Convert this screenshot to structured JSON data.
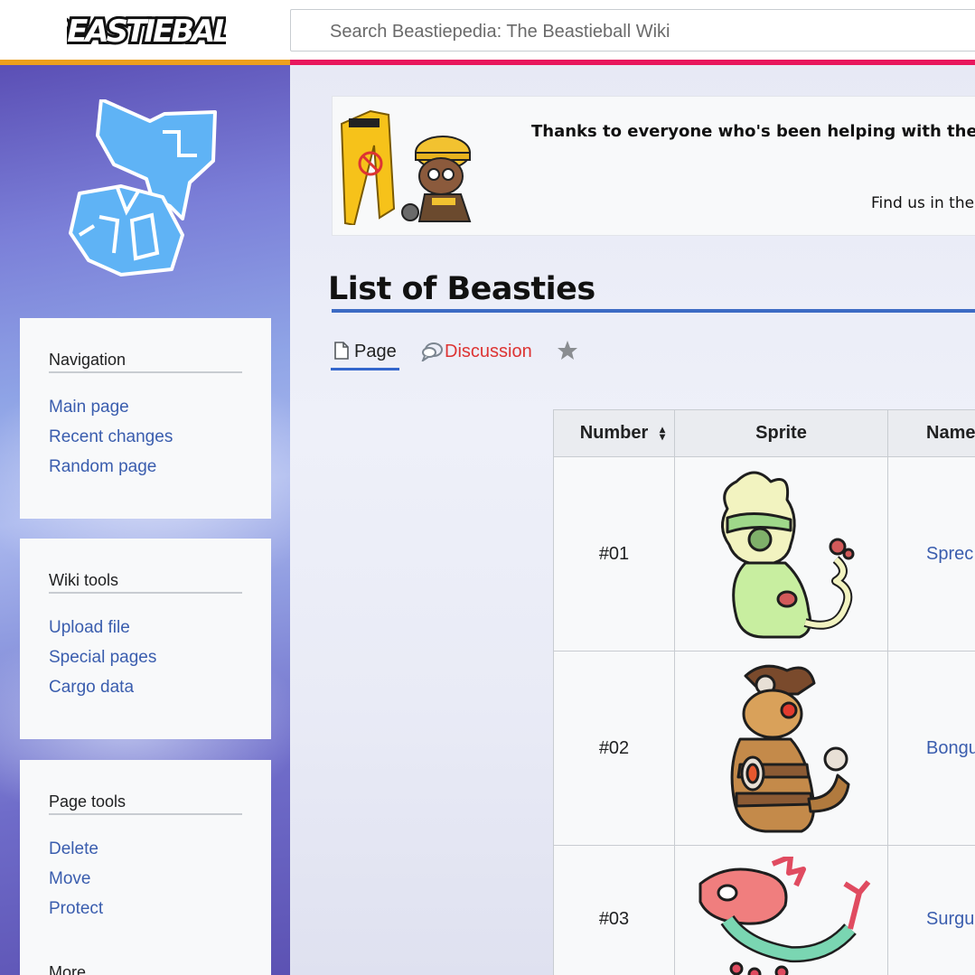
{
  "header": {
    "logo_text": "BEASTIEBALL",
    "search_placeholder": "Search Beastiepedia: The Beastieball Wiki"
  },
  "colors": {
    "accent_orange": "#ec9f1d",
    "accent_pink": "#e8175d",
    "link": "#3a5dae",
    "redlink": "#d33",
    "title_rule": "#3d6bc4"
  },
  "sidebar": {
    "emblem": "site-emblem-logo",
    "portlets": [
      {
        "title": "Navigation",
        "links": [
          "Main page",
          "Recent changes",
          "Random page"
        ]
      },
      {
        "title": "Wiki tools",
        "links": [
          "Upload file",
          "Special pages",
          "Cargo data"
        ]
      },
      {
        "title": "Page tools",
        "links": [
          "Delete",
          "Move",
          "Protect"
        ],
        "more": "More"
      }
    ]
  },
  "banner": {
    "thanks": "Thanks to everyone who's been helping with the site",
    "find": "Find us in the",
    "art": "caution-wet-floor-sign-and-construction-worker"
  },
  "page": {
    "title": "List of Beasties",
    "tabs": {
      "page": "Page",
      "discussion": "Discussion"
    },
    "icons": {
      "page": "page-icon",
      "discussion": "discussion-icon",
      "watch": "star-icon"
    }
  },
  "table": {
    "headers": {
      "number": "Number",
      "sprite": "Sprite",
      "name": "Name"
    },
    "rows": [
      {
        "number": "#01",
        "name": "Sprec",
        "sprite": "sprecko-sprite"
      },
      {
        "number": "#02",
        "name": "Bongu",
        "sprite": "bongo-sprite"
      },
      {
        "number": "#03",
        "name": "Surgu",
        "sprite": "surgu-sprite"
      }
    ]
  }
}
